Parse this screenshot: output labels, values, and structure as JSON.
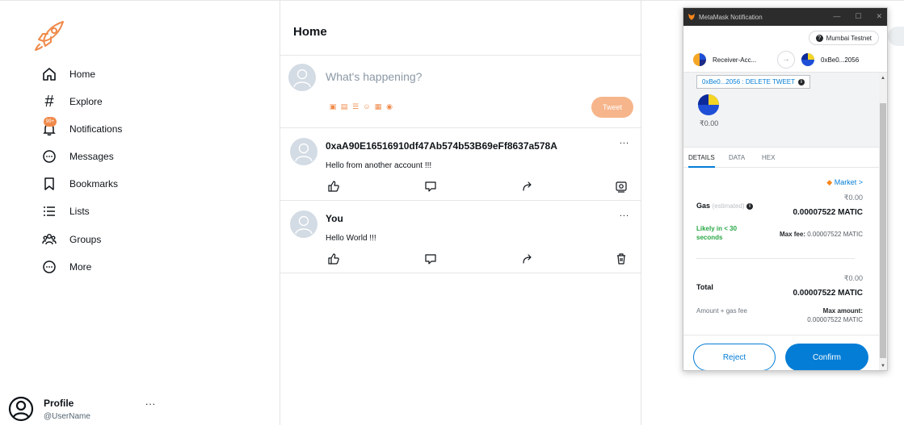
{
  "sidebar": {
    "items": [
      {
        "label": "Home",
        "icon": "home-icon"
      },
      {
        "label": "Explore",
        "icon": "hashtag-icon"
      },
      {
        "label": "Notifications",
        "icon": "bell-icon",
        "badge": "99+"
      },
      {
        "label": "Messages",
        "icon": "message-icon"
      },
      {
        "label": "Bookmarks",
        "icon": "bookmark-icon"
      },
      {
        "label": "Lists",
        "icon": "list-icon"
      },
      {
        "label": "Groups",
        "icon": "groups-icon"
      },
      {
        "label": "More",
        "icon": "more-icon"
      }
    ],
    "profile": {
      "name": "Profile",
      "handle": "@UserName",
      "more": "..."
    }
  },
  "feed": {
    "title": "Home",
    "composer": {
      "placeholder": "What's happening?",
      "tweet_label": "Tweet"
    },
    "tweets": [
      {
        "author": "0xaA90E16516910df47Ab574b53B69eFf8637a578A",
        "text": "Hello from another account !!!",
        "more": "..."
      },
      {
        "author": "You",
        "text": "Hello World !!!",
        "more": "..."
      }
    ]
  },
  "metamask": {
    "window_title": "MetaMask Notification",
    "network": "Mumbai Testnet",
    "from_account": "Receiver-Acc...",
    "to_account": "0xBe0...2056",
    "origin": "0xBe0...2056 : DELETE TWEET",
    "value": "₹0.00",
    "tabs": [
      "DETAILS",
      "DATA",
      "HEX"
    ],
    "market": "Market >",
    "gas_label": "Gas",
    "gas_estimated": "(estimated)",
    "gas_inr": "₹0.00",
    "gas_matic": "0.00007522 MATIC",
    "likely": "Likely in < 30 seconds",
    "max_fee_label": "Max fee:",
    "max_fee_value": "0.00007522 MATIC",
    "total_inr": "₹0.00",
    "total_label": "Total",
    "total_matic": "0.00007522 MATIC",
    "amount_gas_label": "Amount + gas fee",
    "max_amount_label": "Max amount:",
    "max_amount_value": "0.00007522 MATIC",
    "reject_label": "Reject",
    "confirm_label": "Confirm"
  },
  "colors": {
    "accent": "#f08a4b",
    "tweet_button": "#f6b58b",
    "metamask_blue": "#037dd6",
    "success_green": "#28a745"
  }
}
